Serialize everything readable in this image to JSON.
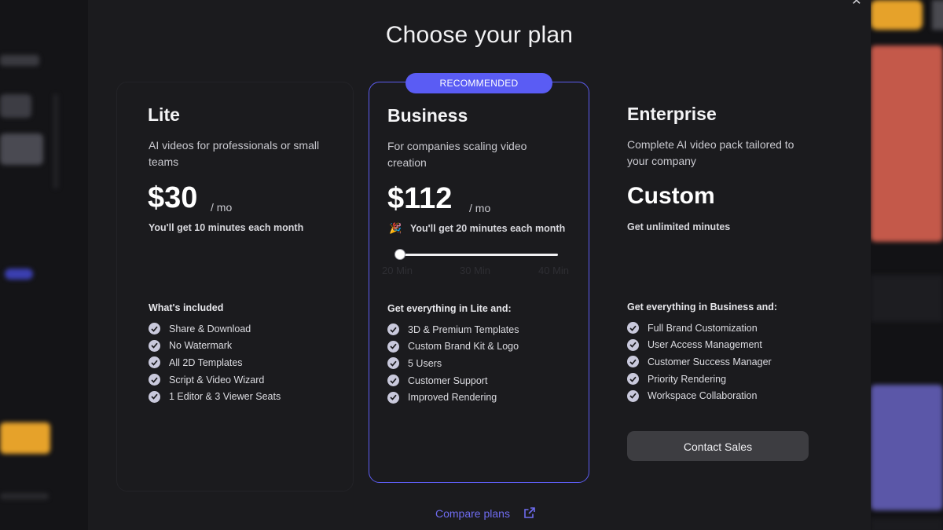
{
  "modal": {
    "title": "Choose your plan",
    "close_icon": "close-icon"
  },
  "colors": {
    "accent": "#5a5cf4",
    "business_border": "#5c5cf0",
    "link": "#6f6cf0",
    "modal_bg": "#1b1b1e"
  },
  "plans": {
    "lite": {
      "name": "Lite",
      "description": "AI videos for professionals or small teams",
      "price": "$30",
      "period": "/ mo",
      "minutes": "You'll get 10 minutes each month",
      "features_heading": "What's included",
      "features": [
        "Share & Download",
        "No Watermark",
        "All 2D Templates",
        "Script & Video Wizard",
        "1 Editor & 3 Viewer Seats"
      ]
    },
    "business": {
      "badge": "RECOMMENDED",
      "name": "Business",
      "description": "For companies scaling video creation",
      "price": "$112",
      "period": "/ mo",
      "minutes_icon": "party-popper-icon",
      "minutes": "You'll get 20 minutes each month",
      "slider": {
        "ticks": [
          "20 Min",
          "30 Min",
          "40 Min"
        ],
        "value": "20 Min"
      },
      "features_heading": "Get everything in Lite and:",
      "features": [
        "3D & Premium Templates",
        "Custom Brand Kit & Logo",
        "5 Users",
        "Customer Support",
        "Improved Rendering"
      ]
    },
    "enterprise": {
      "name": "Enterprise",
      "description": "Complete AI video pack tailored to your company",
      "price": "Custom",
      "minutes": "Get unlimited minutes",
      "features_heading": "Get everything in Business and:",
      "features": [
        "Full Brand Customization",
        "User Access Management",
        "Customer Success Manager",
        "Priority Rendering",
        "Workspace Collaboration"
      ],
      "cta": "Contact Sales"
    }
  },
  "footer": {
    "compare_link": "Compare plans",
    "compare_icon": "external-link-icon"
  }
}
